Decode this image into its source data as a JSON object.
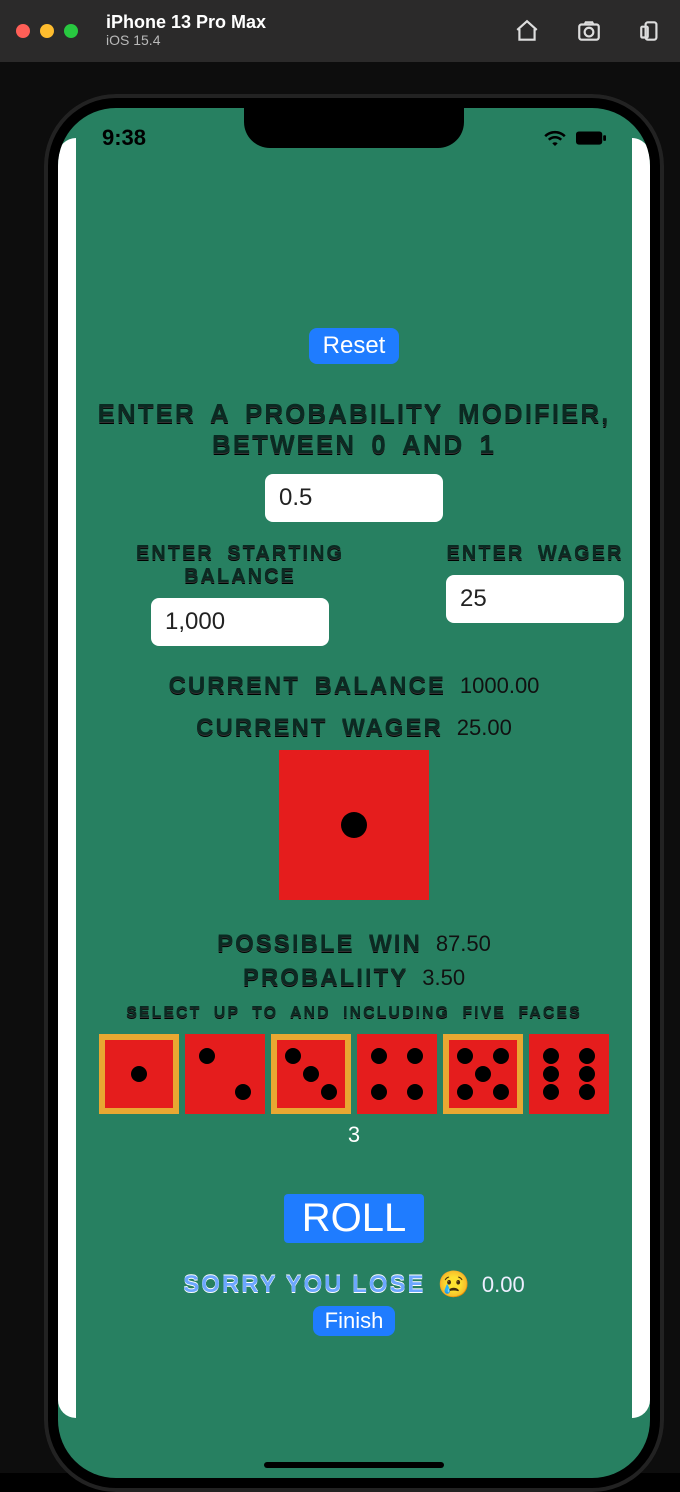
{
  "window": {
    "device": "iPhone 13 Pro Max",
    "os": "iOS 15.4"
  },
  "status": {
    "time": "9:38"
  },
  "buttons": {
    "reset": "Reset",
    "roll": "ROLL",
    "finish": "Finish"
  },
  "labels": {
    "prob_mod": "ENTER A PROBABILITY MODIFIER, BETWEEN 0 AND 1",
    "balance_lbl": "ENTER STARTING BALANCE",
    "wager_lbl": "ENTER WAGER",
    "cur_balance": "CURRENT BALANCE",
    "cur_wager": "CURRENT WAGER",
    "poss_win": "POSSIBLE WIN",
    "probability": "PROBALIITY",
    "select_faces": "SELECT UP TO AND INCLUDING FIVE FACES",
    "result": "SORRY YOU LOSE"
  },
  "inputs": {
    "prob_mod": "0.5",
    "balance": "1,000",
    "wager": "25"
  },
  "values": {
    "cur_balance": "1000.00",
    "cur_wager": "25.00",
    "poss_win": "87.50",
    "probability": "3.50",
    "selected_count": "3",
    "rolled_face": "1",
    "result_amount": "0.00",
    "result_emoji": "😢"
  },
  "dice": {
    "faces": [
      1,
      2,
      3,
      4,
      5,
      6
    ],
    "selected": [
      1,
      3,
      5
    ]
  }
}
